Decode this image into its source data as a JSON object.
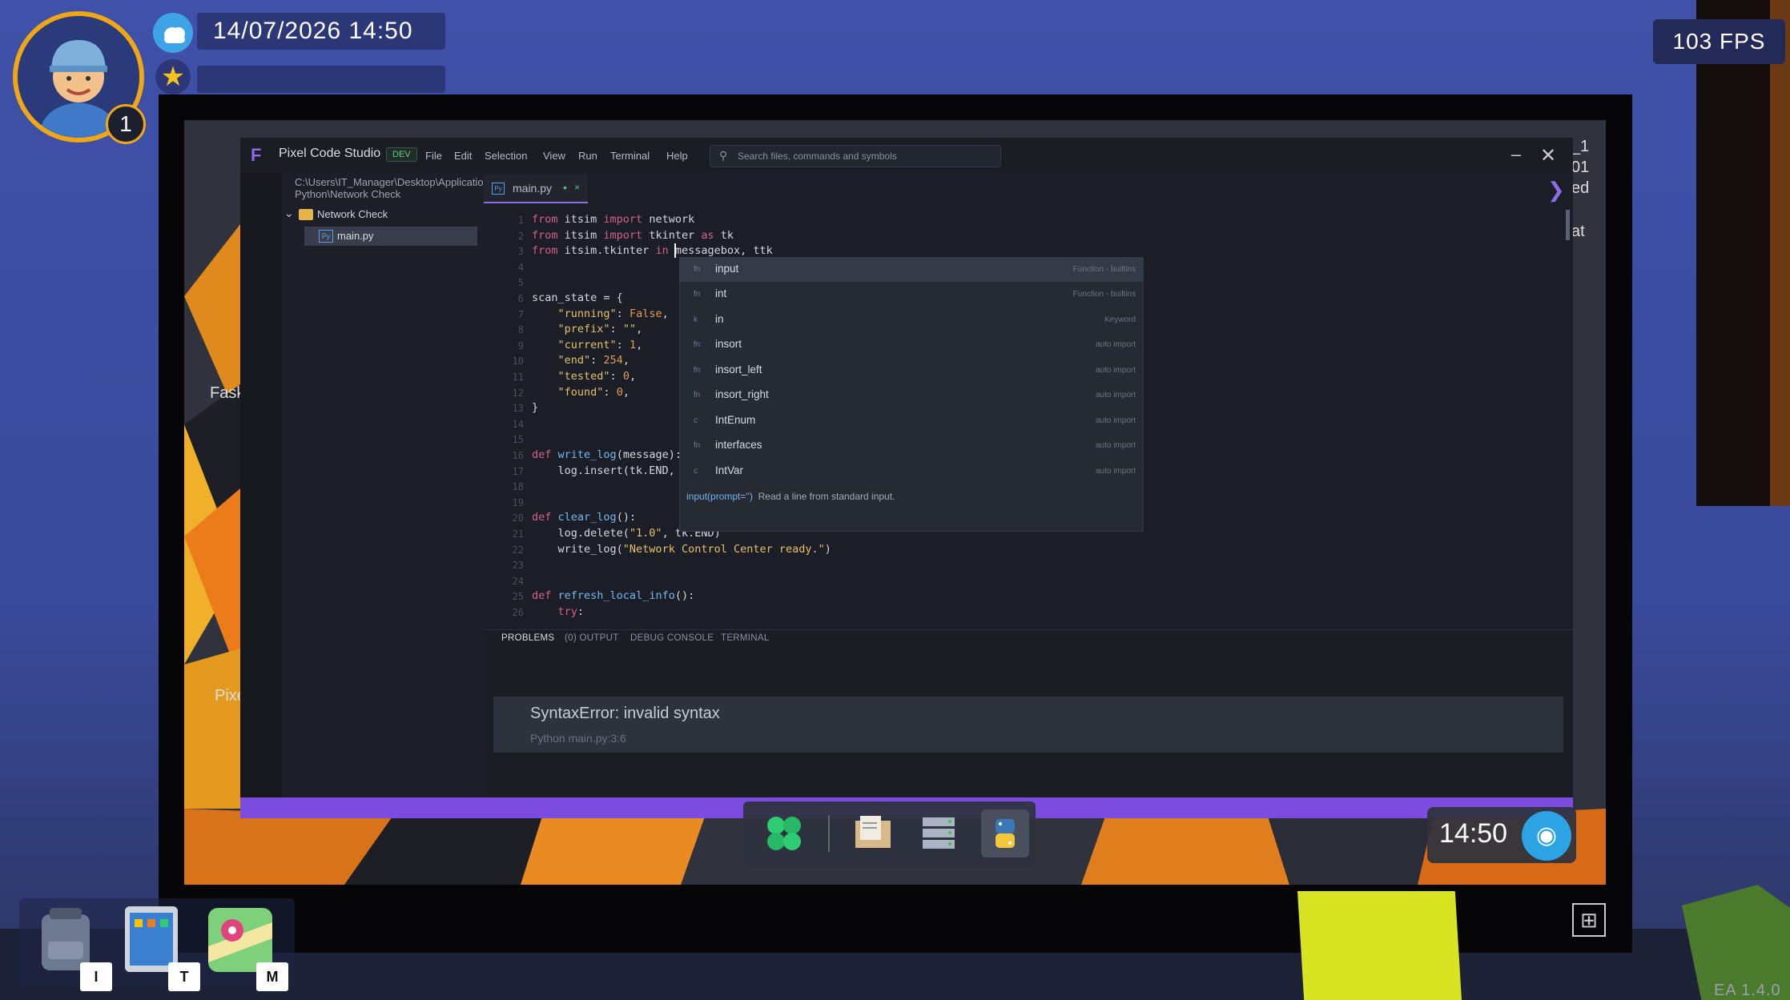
{
  "hud": {
    "level": "1",
    "datetime": "14/07/2026  14:50",
    "fps": "103 FPS",
    "inventory": [
      {
        "icon": "backpack-icon",
        "key": "I"
      },
      {
        "icon": "tablet-icon",
        "key": "T"
      },
      {
        "icon": "map-icon",
        "key": "M"
      }
    ],
    "version": "EA 1.4.0"
  },
  "desktop": {
    "side_labels": [
      "Fask",
      "Pixe"
    ],
    "right_fragments": [
      "_1",
      "01",
      "ed",
      "at"
    ],
    "clock": "14:50",
    "dock": [
      "launcher-icon",
      "files-icon",
      "server-icon",
      "python-icon"
    ]
  },
  "ide": {
    "app_name": "Pixel Code Studio",
    "badge": "DEV",
    "menu": [
      "File",
      "Edit",
      "Selection",
      "View",
      "Run",
      "Terminal",
      "Help"
    ],
    "search_placeholder": "Search files, commands and symbols",
    "explorer": {
      "path": "C:\\Users\\IT_Manager\\Desktop\\Application Python\\Network Check",
      "folder": "Network Check",
      "file": "main.py"
    },
    "tab": {
      "label": "main.py",
      "dot": "•",
      "close": "×"
    },
    "line_numbers": [
      "1",
      "2",
      "3",
      "4",
      "5",
      "6",
      "7",
      "8",
      "9",
      "10",
      "11",
      "12",
      "13",
      "14",
      "15",
      "16",
      "17",
      "18",
      "19",
      "20",
      "21",
      "22",
      "23",
      "24",
      "25",
      "26"
    ],
    "autocomplete": {
      "items": [
        {
          "kind": "fn",
          "label": "input",
          "detail": "Function - builtins"
        },
        {
          "kind": "fn",
          "label": "int",
          "detail": "Function - builtins"
        },
        {
          "kind": "k",
          "label": "in",
          "detail": "Keyword"
        },
        {
          "kind": "fn",
          "label": "insort",
          "detail": "auto import"
        },
        {
          "kind": "fn",
          "label": "insort_left",
          "detail": "auto import"
        },
        {
          "kind": "fn",
          "label": "insort_right",
          "detail": "auto import"
        },
        {
          "kind": "c",
          "label": "IntEnum",
          "detail": "auto import"
        },
        {
          "kind": "fn",
          "label": "interfaces",
          "detail": "auto import"
        },
        {
          "kind": "c",
          "label": "IntVar",
          "detail": "auto import"
        }
      ],
      "doc_sig": "input(prompt='')",
      "doc_text": "Read a line from standard input."
    },
    "panel_tabs": [
      "PROBLEMS",
      "(0) OUTPUT",
      "DEBUG CONSOLE",
      "TERMINAL"
    ],
    "problem": {
      "message": "SyntaxError: invalid syntax",
      "source": "Python  main.py:3:6"
    }
  },
  "colors": {
    "accent": "#7c4be0",
    "keyword": "#d3628a",
    "string": "#e6c067",
    "number": "#e39a55",
    "function": "#72b7f2"
  }
}
